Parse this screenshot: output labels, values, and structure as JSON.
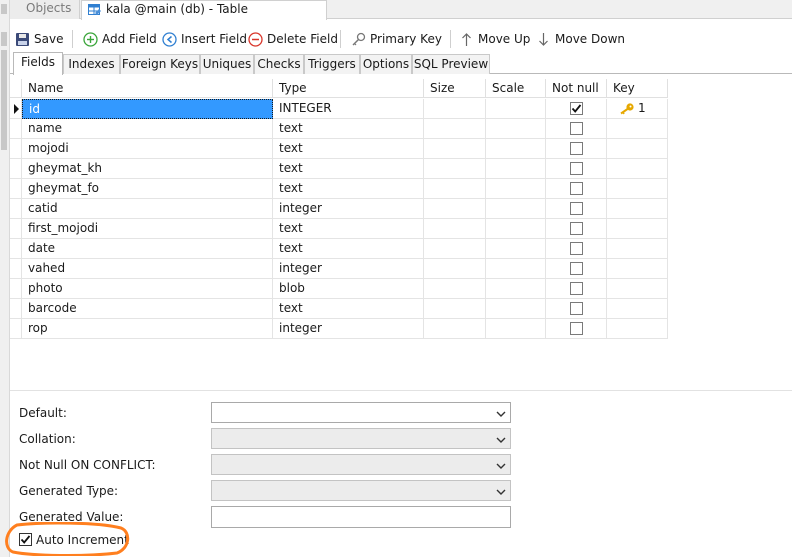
{
  "window": {
    "tab_objects": "Objects",
    "tab_table": "kala @main (db) - Table"
  },
  "toolbar": {
    "save": "Save",
    "add_field": "Add Field",
    "insert_field": "Insert Field",
    "delete_field": "Delete Field",
    "primary_key": "Primary Key",
    "move_up": "Move Up",
    "move_down": "Move Down"
  },
  "subtabs": [
    "Fields",
    "Indexes",
    "Foreign Keys",
    "Uniques",
    "Checks",
    "Triggers",
    "Options",
    "SQL Preview"
  ],
  "grid": {
    "columns": [
      "Name",
      "Type",
      "Size",
      "Scale",
      "Not null",
      "Key"
    ],
    "rows": [
      {
        "name": "id",
        "type": "INTEGER",
        "size": "",
        "scale": "",
        "not_null": true,
        "key": "1"
      },
      {
        "name": "name",
        "type": "text",
        "size": "",
        "scale": "",
        "not_null": false,
        "key": ""
      },
      {
        "name": "mojodi",
        "type": "text",
        "size": "",
        "scale": "",
        "not_null": false,
        "key": ""
      },
      {
        "name": "gheymat_kh",
        "type": "text",
        "size": "",
        "scale": "",
        "not_null": false,
        "key": ""
      },
      {
        "name": "gheymat_fo",
        "type": "text",
        "size": "",
        "scale": "",
        "not_null": false,
        "key": ""
      },
      {
        "name": "catid",
        "type": "integer",
        "size": "",
        "scale": "",
        "not_null": false,
        "key": ""
      },
      {
        "name": "first_mojodi",
        "type": "text",
        "size": "",
        "scale": "",
        "not_null": false,
        "key": ""
      },
      {
        "name": "date",
        "type": "text",
        "size": "",
        "scale": "",
        "not_null": false,
        "key": ""
      },
      {
        "name": "vahed",
        "type": "integer",
        "size": "",
        "scale": "",
        "not_null": false,
        "key": ""
      },
      {
        "name": "photo",
        "type": "blob",
        "size": "",
        "scale": "",
        "not_null": false,
        "key": ""
      },
      {
        "name": "barcode",
        "type": "text",
        "size": "",
        "scale": "",
        "not_null": false,
        "key": ""
      },
      {
        "name": "rop",
        "type": "integer",
        "size": "",
        "scale": "",
        "not_null": false,
        "key": ""
      }
    ]
  },
  "properties": {
    "default_label": "Default:",
    "default_value": "",
    "collation_label": "Collation:",
    "collation_value": "",
    "not_null_conflict_label": "Not Null ON CONFLICT:",
    "not_null_conflict_value": "",
    "generated_type_label": "Generated Type:",
    "generated_type_value": "",
    "generated_value_label": "Generated Value:",
    "generated_value_value": "",
    "auto_increment_label": "Auto Increment",
    "auto_increment_checked": true
  },
  "colors": {
    "selection": "#3399ff",
    "highlight_circle": "#ff7f1f",
    "key_icon": "#e6a800"
  }
}
